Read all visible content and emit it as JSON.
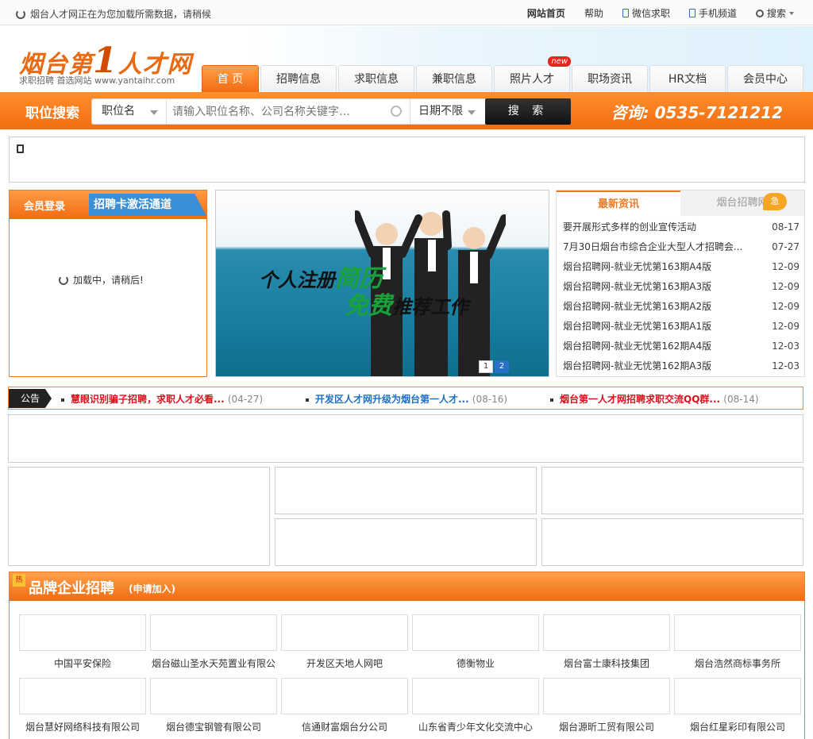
{
  "topbar": {
    "loading": "烟台人才网正在为您加载所需数据，请稍候",
    "links": [
      "网站首页",
      "帮助",
      "微信求职",
      "手机频道",
      "搜索"
    ]
  },
  "header": {
    "logo_text_a": "烟台第",
    "logo_text_num": "1",
    "logo_text_b": "人才网",
    "slogan": "求职招聘 首选网站 www.yantaihr.com",
    "nav": [
      "首 页",
      "招聘信息",
      "求职信息",
      "兼职信息",
      "照片人才",
      "职场资讯",
      "HR文档",
      "会员中心"
    ],
    "new_badge": "new"
  },
  "search": {
    "title": "职位搜索",
    "type": "职位名",
    "placeholder": "请输入职位名称、公司名称关键字…",
    "date": "日期不限",
    "button": "搜 索",
    "hotline": "咨询: 0535-7121212"
  },
  "login": {
    "title": "会员登录",
    "activate": "招聘卡激活通道",
    "loading": "加载中，请稍后!"
  },
  "banner": {
    "line1a": "个人注册",
    "line1b": "简历",
    "line2a": "免费",
    "line2b": "推荐工作",
    "pages": [
      "1",
      "2"
    ]
  },
  "news": {
    "tab_latest": "最新资讯",
    "tab_jobnews": "烟台招聘网",
    "urgent": "急",
    "items": [
      {
        "title": "要开展形式多样的创业宣传活动",
        "date": "08-17"
      },
      {
        "title": "7月30日烟台市综合企业大型人才招聘会...",
        "date": "07-27"
      },
      {
        "title": "烟台招聘网-就业无忧第163期A4版",
        "date": "12-09"
      },
      {
        "title": "烟台招聘网-就业无忧第163期A3版",
        "date": "12-09"
      },
      {
        "title": "烟台招聘网-就业无忧第163期A2版",
        "date": "12-09"
      },
      {
        "title": "烟台招聘网-就业无忧第163期A1版",
        "date": "12-09"
      },
      {
        "title": "烟台招聘网-就业无忧第162期A4版",
        "date": "12-03"
      },
      {
        "title": "烟台招聘网-就业无忧第162期A3版",
        "date": "12-03"
      }
    ]
  },
  "notice": {
    "label": "公告",
    "items": [
      {
        "title": "慧眼识别骗子招聘，求职人才必看...",
        "date": "(04-27)",
        "color": "#d8121b"
      },
      {
        "title": "开发区人才网升级为烟台第一人才...",
        "date": "(08-16)",
        "color": "#1d6fc8"
      },
      {
        "title": "烟台第一人才网招聘求职交流QQ群...",
        "date": "(08-14)",
        "color": "#d8121b"
      }
    ]
  },
  "brand": {
    "hot": "热",
    "title": "品牌企业招聘",
    "join": "(申请加入)",
    "companies": [
      "中国平安保险",
      "烟台磁山圣水天苑置业有限公",
      "开发区天地人网吧",
      "德衡物业",
      "烟台富士康科技集团",
      "烟台浩然商标事务所",
      "烟台慧好网络科技有限公司",
      "烟台德宝钢管有限公司",
      "信通财富烟台分公司",
      "山东省青少年文化交流中心",
      "烟台源昕工贸有限公司",
      "烟台红星彩印有限公司"
    ]
  },
  "colors": {
    "accent": "#f36d0f",
    "link_blue": "#1d6fc8",
    "alert_red": "#d8121b"
  }
}
